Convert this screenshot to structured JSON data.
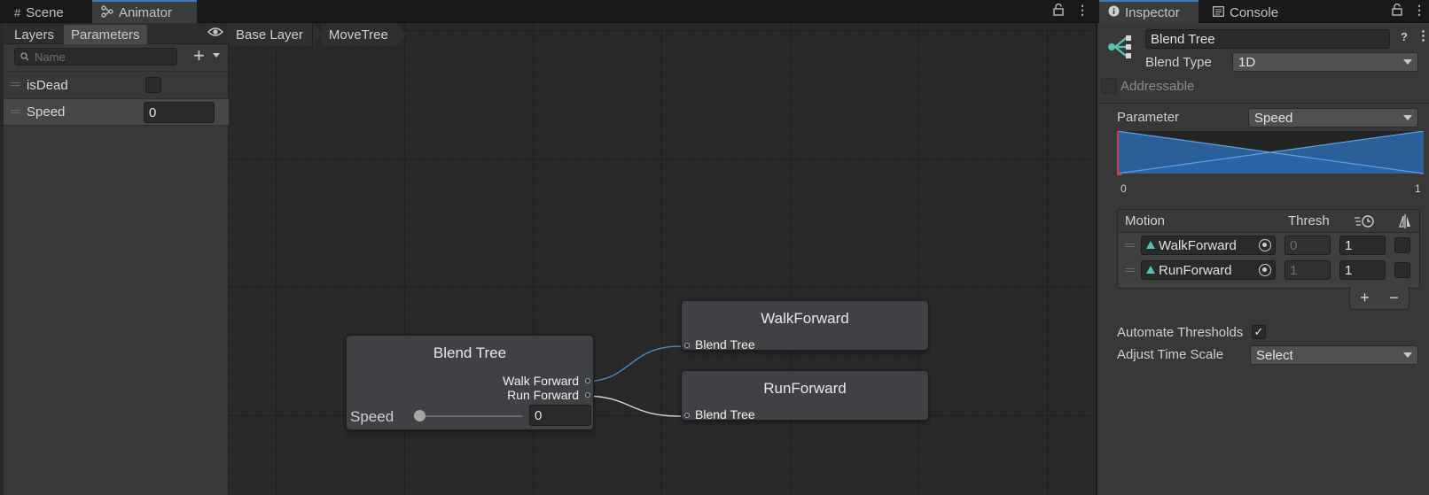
{
  "colors": {
    "accent": "#3a79bb",
    "graph_bg": "#282828",
    "node_bg": "#3f4144",
    "blend_fill": "#2b66a6",
    "transition_line": "#4c88c4"
  },
  "left_window": {
    "tabs": [
      {
        "label": "Scene",
        "icon": "grid-icon"
      },
      {
        "label": "Animator",
        "icon": "animator-icon"
      }
    ]
  },
  "params_panel": {
    "tabs": {
      "layers": "Layers",
      "parameters": "Parameters"
    },
    "search_placeholder": "Name",
    "add_label": "+",
    "params": [
      {
        "name": "isDead",
        "type": "bool",
        "value": false
      },
      {
        "name": "Speed",
        "type": "float",
        "value": "0"
      }
    ]
  },
  "graph": {
    "breadcrumb": [
      "Base Layer",
      "MoveTree"
    ],
    "blend_node": {
      "title": "Blend Tree",
      "outputs": [
        "Walk Forward",
        "Run Forward"
      ],
      "param_label": "Speed",
      "param_value": "0"
    },
    "walk_node": {
      "title": "WalkForward",
      "input": "Blend Tree"
    },
    "run_node": {
      "title": "RunForward",
      "input": "Blend Tree"
    }
  },
  "inspector": {
    "tabs": [
      {
        "label": "Inspector",
        "icon": "info-icon"
      },
      {
        "label": "Console",
        "icon": "console-icon"
      }
    ],
    "name": "Blend Tree",
    "blend_type_label": "Blend Type",
    "blend_type_value": "1D",
    "addressable_label": "Addressable",
    "parameter_label": "Parameter",
    "parameter_value": "Speed",
    "range_min": "0",
    "range_max": "1",
    "motion_headers": {
      "motion": "Motion",
      "thresh": "Thresh"
    },
    "motions": [
      {
        "name": "WalkForward",
        "thresh": "0",
        "speed": "1"
      },
      {
        "name": "RunForward",
        "thresh": "1",
        "speed": "1"
      }
    ],
    "add_label": "+",
    "remove_label": "−",
    "automate_label": "Automate Thresholds",
    "automate_checked": true,
    "adjust_label": "Adjust Time Scale",
    "adjust_value": "Select"
  }
}
